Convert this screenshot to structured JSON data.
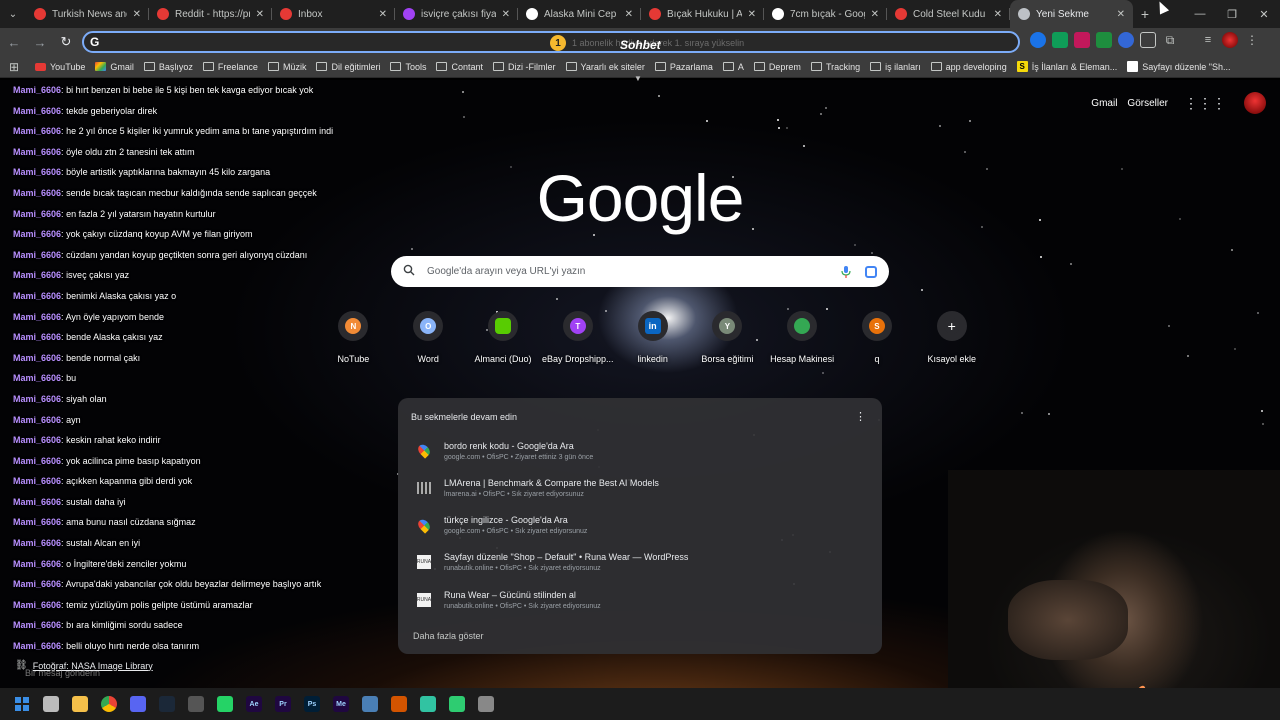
{
  "tabs": [
    {
      "title": "Turkish News and Di",
      "favicon_color": "#e53935"
    },
    {
      "title": "Reddit - https://previ",
      "favicon_color": "#e53935"
    },
    {
      "title": "Inbox",
      "favicon_color": "#e53935"
    },
    {
      "title": "isviçre çakısı fiyat - G",
      "favicon_color": "#a142f4"
    },
    {
      "title": "Alaska Mini Cep Çakı",
      "favicon_color": "#ffffff"
    },
    {
      "title": "Bıçak Hukuku | Ankar",
      "favicon_color": "#e53935"
    },
    {
      "title": "7cm bıçak - Google'd",
      "favicon_color": "#ffffff"
    },
    {
      "title": "Cold Steel Kudu Oka",
      "favicon_color": "#e53935"
    },
    {
      "title": "Yeni Sekme",
      "favicon_color": "#bdc1c6",
      "active": true
    }
  ],
  "toolbar": {
    "omnibox_value": "",
    "omnibox_icon": "G",
    "notification_badge": "1",
    "notification_text": "1 abonelik hediye ederek 1. sıraya yükselin",
    "overlay_brand": "Sohbet"
  },
  "bookmarks": [
    {
      "label": "YouTube",
      "icon": "youtube-icon"
    },
    {
      "label": "Gmail",
      "icon": "gmail-icon"
    },
    {
      "label": "Başlıyoz",
      "icon": "folder-icon"
    },
    {
      "label": "Freelance",
      "icon": "folder-icon"
    },
    {
      "label": "Müzik",
      "icon": "folder-icon"
    },
    {
      "label": "Dil eğitimleri",
      "icon": "folder-icon"
    },
    {
      "label": "Tools",
      "icon": "folder-icon"
    },
    {
      "label": "Contant",
      "icon": "folder-icon"
    },
    {
      "label": "Dizi -Filmler",
      "icon": "folder-icon"
    },
    {
      "label": "Yararlı ek siteler",
      "icon": "folder-icon"
    },
    {
      "label": "Pazarlama",
      "icon": "folder-icon"
    },
    {
      "label": "A",
      "icon": "folder-icon"
    },
    {
      "label": "Deprem",
      "icon": "folder-icon"
    },
    {
      "label": "Tracking",
      "icon": "folder-icon"
    },
    {
      "label": "iş ilanları",
      "icon": "folder-icon"
    },
    {
      "label": "app developing",
      "icon": "folder-icon"
    },
    {
      "label": "İş İlanları & Eleman...",
      "icon": "s-icon"
    },
    {
      "label": "Sayfayı düzenle \"Sh...",
      "icon": "page-icon"
    }
  ],
  "chat": {
    "username": "Mami_6606",
    "messages": [
      "bi hırt benzen bi bebe ile 5 kişi ben tek kavga ediyor bıcak yok",
      "tekde geberiyolar direk",
      "he 2 yıl önce 5 kişiler iki yumruk yedim ama bı tane yapıştırdım indi",
      "öyle oldu ztn 2 tanesini tek attım",
      "böyle artistik yaptıklarına bakmayın 45 kilo zargana",
      "sende bıcak taşıcan mecbur kaldığında sende saplıcan geççek",
      "en fazla 2 yıl yatarsın hayatın kurtulur",
      "yok çakıyı cüzdanq koyup AVM ye filan giriyom",
      "cüzdanı yandan koyup geçtikten sonra geri alıyonyq cüzdanı",
      "isveç çakısı yaz",
      "benimki Alaska çakısı yaz o",
      "Ayn öyle yapıyom bende",
      "bende Alaska çakısı yaz",
      "bende normal çakı",
      "bu",
      "siyah olan",
      "ayn",
      "keskin rahat keko indirir",
      "yok acilinca pime basıp kapatıyon",
      "açıkken kapanma gibi derdi yok",
      "sustalı daha iyi",
      "ama bunu nasıl cüzdana sığmaz",
      "sustalı Alcan en iyi",
      "o İngiltere'deki zenciler yokmu",
      "Avrupa'daki yabancılar çok oldu beyazlar delirmeye başlıyo artık",
      "temiz yüzlüyüm polis gelipte üstümü aramazlar",
      "bı ara kimliğimi sordu sadece",
      "belli oluyo hırtı nerde olsa tanırım"
    ],
    "input_placeholder": "Bir mesaj gönderin"
  },
  "photo_credit": "Fotoğraf: NASA Image Library",
  "header_links": {
    "gmail": "Gmail",
    "images": "Görseller"
  },
  "logo": "Google",
  "search": {
    "placeholder": "Google'da arayın veya URL'yi yazın"
  },
  "shortcuts": [
    {
      "label": "NoTube",
      "letter": "N",
      "color": "#f28b36"
    },
    {
      "label": "Word",
      "letter": "O",
      "color": "#8ab4f8"
    },
    {
      "label": "Almanci (Duo)",
      "letter": "",
      "color": "#58cc02"
    },
    {
      "label": "eBay Dropshipp...",
      "letter": "T",
      "color": "#a142f4"
    },
    {
      "label": "linkedin",
      "letter": "in",
      "color": "#0a66c2"
    },
    {
      "label": "Borsa eğitimi",
      "letter": "Y",
      "color": "#7a8a78"
    },
    {
      "label": "Hesap Makinesi",
      "letter": "",
      "color": "#34a853"
    },
    {
      "label": "q",
      "letter": "S",
      "color": "#e8710a"
    },
    {
      "label": "Kısayol ekle",
      "letter": "+",
      "color": "#2a2a2e"
    }
  ],
  "continue_card": {
    "title": "Bu sekmelerle devam edin",
    "items": [
      {
        "title": "bordo renk kodu - Google'da Ara",
        "subtitle": "google.com • OfisPC • Ziyaret ettiniz 3 gün önce",
        "icon": "maps-pin-icon"
      },
      {
        "title": "LMArena | Benchmark & Compare the Best AI Models",
        "subtitle": "lmarena.ai • OfisPC • Sık ziyaret ediyorsunuz",
        "icon": "lmarena-icon"
      },
      {
        "title": "türkçe ingilizce - Google'da Ara",
        "subtitle": "google.com • OfisPC • Sık ziyaret ediyorsunuz",
        "icon": "maps-pin-icon"
      },
      {
        "title": "Sayfayı düzenle \"Shop – Default\" • Runa Wear — WordPress",
        "subtitle": "runabutik.online • OfisPC • Sık ziyaret ediyorsunuz",
        "icon": "runa-wear-icon"
      },
      {
        "title": "Runa Wear – Gücünü stilinden al",
        "subtitle": "runabutik.online • OfisPC • Sık ziyaret ediyorsunuz",
        "icon": "runa-wear-icon"
      }
    ],
    "more": "Daha fazla göster"
  },
  "taskbar": [
    {
      "icon": "windows-start-icon",
      "color": "#3a8ee6",
      "text": ""
    },
    {
      "icon": "task-view-icon",
      "color": "#bbbbbb",
      "text": ""
    },
    {
      "icon": "file-explorer-icon",
      "color": "#f5c04a",
      "text": ""
    },
    {
      "icon": "chrome-icon",
      "color": "#4285f4",
      "text": ""
    },
    {
      "icon": "discord-icon",
      "color": "#5865f2",
      "text": ""
    },
    {
      "icon": "steam-icon",
      "color": "#1b2838",
      "text": ""
    },
    {
      "icon": "clock-app-icon",
      "color": "#555555",
      "text": ""
    },
    {
      "icon": "whatsapp-icon",
      "color": "#25d366",
      "text": ""
    },
    {
      "icon": "after-effects-icon",
      "color": "#1f0740",
      "text": "Ae"
    },
    {
      "icon": "premiere-icon",
      "color": "#1f0740",
      "text": "Pr"
    },
    {
      "icon": "photoshop-icon",
      "color": "#001e36",
      "text": "Ps"
    },
    {
      "icon": "media-encoder-icon",
      "color": "#1f0740",
      "text": "Me"
    },
    {
      "icon": "settings-app-icon",
      "color": "#4a7fb5",
      "text": ""
    },
    {
      "icon": "obs-icon",
      "color": "#d35400",
      "text": ""
    },
    {
      "icon": "streamlabs-icon",
      "color": "#31c3a2",
      "text": ""
    },
    {
      "icon": "game-icon",
      "color": "#2ecc71",
      "text": ""
    },
    {
      "icon": "gear-icon",
      "color": "#888888",
      "text": ""
    }
  ]
}
